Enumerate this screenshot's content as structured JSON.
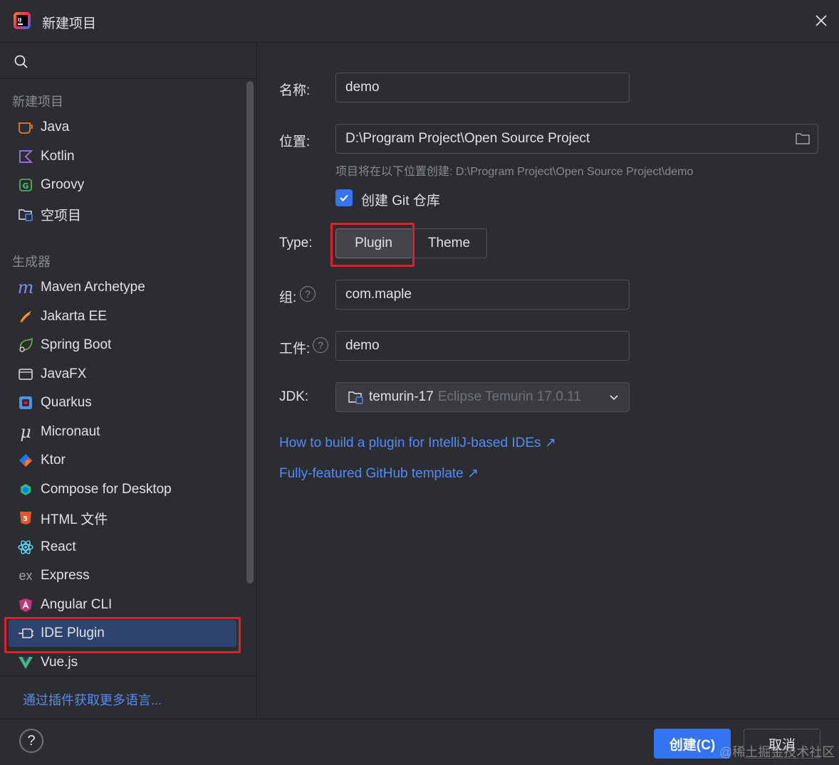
{
  "window": {
    "title": "新建项目"
  },
  "sidebar": {
    "section_new": "新建项目",
    "new_items": [
      {
        "label": "Java",
        "icon": "java-icon"
      },
      {
        "label": "Kotlin",
        "icon": "kotlin-icon"
      },
      {
        "label": "Groovy",
        "icon": "groovy-icon"
      },
      {
        "label": "空项目",
        "icon": "empty-project-icon"
      }
    ],
    "section_generators": "生成器",
    "generators": [
      {
        "label": "Maven Archetype",
        "icon": "maven-icon"
      },
      {
        "label": "Jakarta EE",
        "icon": "jakarta-icon"
      },
      {
        "label": "Spring Boot",
        "icon": "spring-boot-icon"
      },
      {
        "label": "JavaFX",
        "icon": "javafx-icon"
      },
      {
        "label": "Quarkus",
        "icon": "quarkus-icon"
      },
      {
        "label": "Micronaut",
        "icon": "micronaut-icon"
      },
      {
        "label": "Ktor",
        "icon": "ktor-icon"
      },
      {
        "label": "Compose for Desktop",
        "icon": "compose-icon"
      },
      {
        "label": "HTML 文件",
        "icon": "html5-icon"
      },
      {
        "label": "React",
        "icon": "react-icon"
      },
      {
        "label": "Express",
        "icon": "express-icon"
      },
      {
        "label": "Angular CLI",
        "icon": "angular-icon"
      },
      {
        "label": "IDE Plugin",
        "icon": "plugin-icon",
        "selected": true
      },
      {
        "label": "Vue.js",
        "icon": "vue-icon"
      }
    ],
    "more_link": "通过插件获取更多语言..."
  },
  "form": {
    "name_label": "名称:",
    "name_value": "demo",
    "location_label": "位置:",
    "location_value": "D:\\Program Project\\Open Source Project",
    "location_hint": "项目将在以下位置创建: D:\\Program Project\\Open Source Project\\demo",
    "git_label": "创建 Git 仓库",
    "git_checked": true,
    "type_label": "Type:",
    "type_options": [
      "Plugin",
      "Theme"
    ],
    "type_selected": "Plugin",
    "group_label": "组:",
    "group_value": "com.maple",
    "artifact_label": "工件:",
    "artifact_value": "demo",
    "jdk_label": "JDK:",
    "jdk_name": "temurin-17",
    "jdk_desc": "Eclipse Temurin 17.0.11"
  },
  "links": {
    "plugin_guide": "How to build a plugin for IntelliJ-based IDEs ↗",
    "github_template": "Fully-featured GitHub template ↗"
  },
  "buttons": {
    "create": "创建(C)",
    "cancel": "取消"
  },
  "watermark": "@稀土掘金技术社区",
  "colors": {
    "accent": "#3574f0",
    "link": "#548af7",
    "highlight": "#e01f2b",
    "selected_row": "#2e436e"
  }
}
